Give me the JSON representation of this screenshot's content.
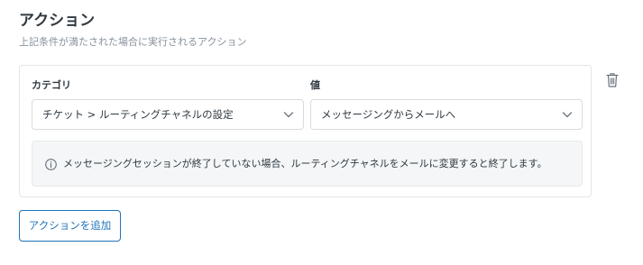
{
  "section": {
    "title": "アクション",
    "subtitle": "上記条件が満たされた場合に実行されるアクション"
  },
  "action": {
    "category_label": "カテゴリ",
    "value_label": "値",
    "category_selected": "チケット > ルーティングチャネルの設定",
    "value_selected": "メッセージングからメールへ",
    "info_message": "メッセージングセッションが終了していない場合、ルーティングチャネルをメールに変更すると終了します。",
    "delete_icon": "trash-icon"
  },
  "buttons": {
    "add_action": "アクションを追加"
  },
  "colors": {
    "accent": "#1f73b7",
    "text": "#2f3941",
    "muted": "#87929d",
    "border": "#d8dcde",
    "info_bg": "#f4f6f7"
  }
}
